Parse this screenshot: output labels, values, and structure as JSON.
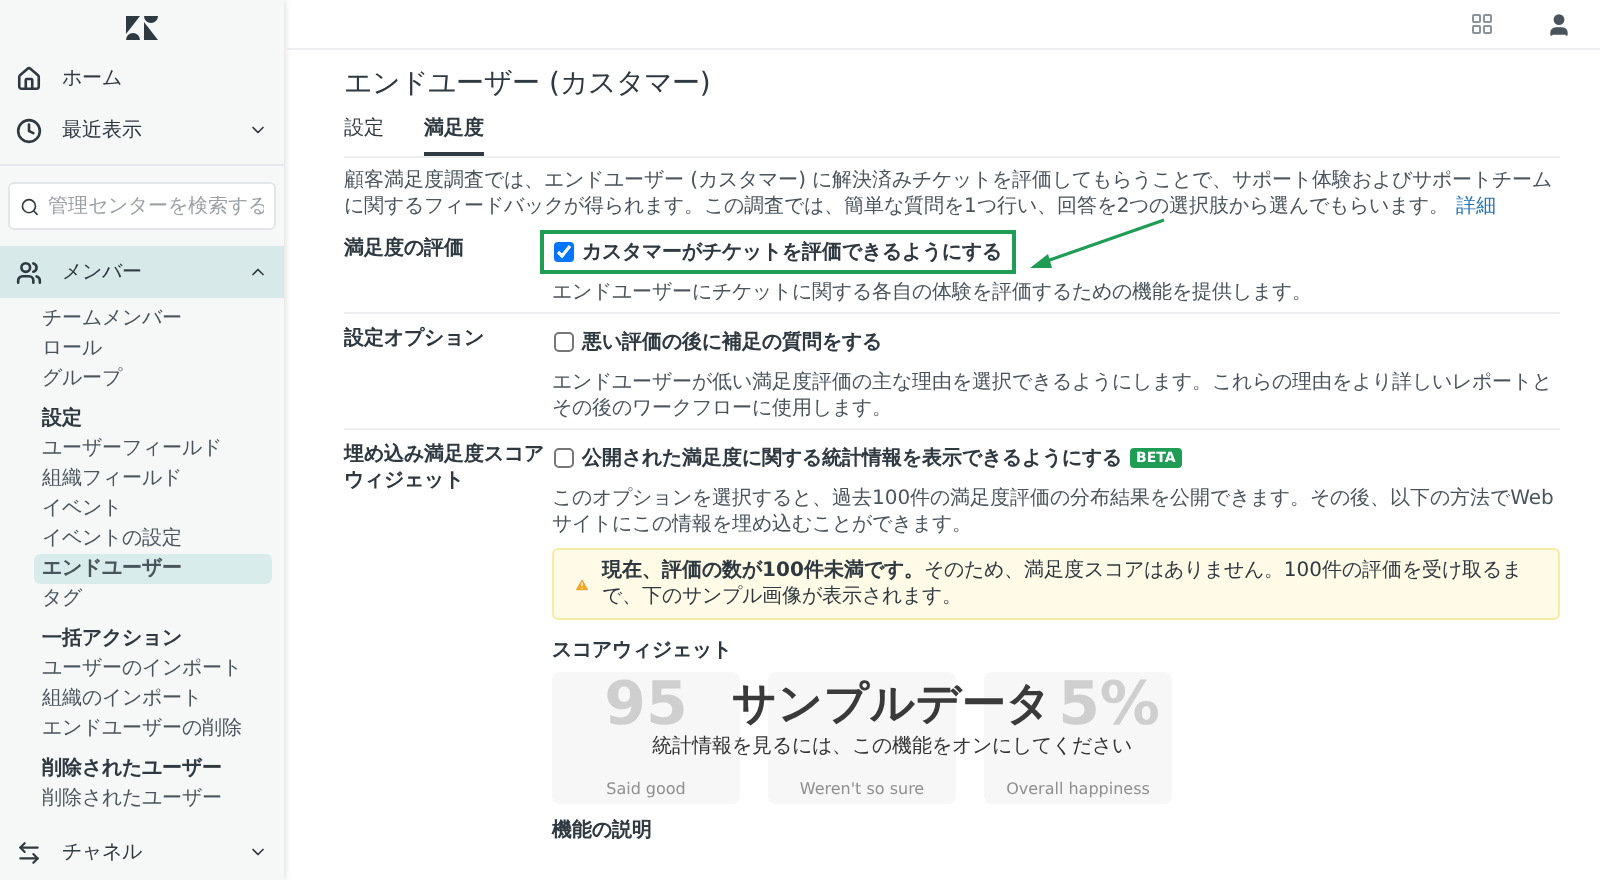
{
  "sidebar": {
    "nav": [
      {
        "label": "ホーム",
        "selected": false
      },
      {
        "label": "最近表示",
        "selected": false,
        "expanded": false
      }
    ],
    "search": {
      "placeholder": "管理センターを検索する"
    },
    "section": {
      "label": "メンバー",
      "selected": true,
      "expanded": true,
      "groups": [
        {
          "items": [
            {
              "label": "チームメンバー",
              "selected": false
            },
            {
              "label": "ロール",
              "selected": false
            },
            {
              "label": "グループ",
              "selected": false
            }
          ]
        },
        {
          "heading": "設定",
          "items": [
            {
              "label": "ユーザーフィールド",
              "selected": false
            },
            {
              "label": "組織フィールド",
              "selected": false
            },
            {
              "label": "イベント",
              "selected": false
            },
            {
              "label": "イベントの設定",
              "selected": false
            },
            {
              "label": "エンドユーザー",
              "selected": true
            },
            {
              "label": "タグ",
              "selected": false
            }
          ]
        },
        {
          "heading": "一括アクション",
          "items": [
            {
              "label": "ユーザーのインポート",
              "selected": false
            },
            {
              "label": "組織のインポート",
              "selected": false
            },
            {
              "label": "エンドユーザーの削除",
              "selected": false
            }
          ]
        },
        {
          "heading": "削除されたユーザー",
          "items": [
            {
              "label": "削除されたユーザー",
              "selected": false
            }
          ]
        }
      ]
    },
    "footer": {
      "label": "チャネル",
      "expanded": false
    }
  },
  "page": {
    "title": "エンドユーザー (カスタマー)",
    "tabs": [
      {
        "label": "設定",
        "selected": false
      },
      {
        "label": "満足度",
        "selected": true
      }
    ],
    "intro": "顧客満足度調査では、エンドユーザー (カスタマー) に解決済みチケットを評価してもらうことで、サポート体験およびサポートチームに関するフィードバックが得られます。この調査では、簡単な質問を1つ行い、回答を2つの選択肢から選んでもらいます。",
    "intro_link": "詳細",
    "settings": [
      {
        "label": "満足度の評価",
        "option": {
          "label": "カスタマーがチケットを評価できるようにする",
          "checked": true,
          "highlighted": true
        },
        "help": "エンドユーザーにチケットに関する各自の体験を評価するための機能を提供します。"
      },
      {
        "label": "設定オプション",
        "option": {
          "label": "悪い評価の後に補足の質問をする",
          "checked": false,
          "highlighted": false
        },
        "help": "エンドユーザーが低い満足度評価の主な理由を選択できるようにします。これらの理由をより詳しいレポートとその後のワークフローに使用します。"
      },
      {
        "label": "埋め込み満足度スコアウィジェット",
        "option": {
          "label": "公開された満足度に関する統計情報を表示できるようにする",
          "checked": false,
          "highlighted": false,
          "badge": "BETA"
        },
        "help": "このオプションを選択すると、過去100件の満足度評価の分布結果を公開できます。その後、以下の方法でWebサイトにこの情報を埋め込むことができます。",
        "notice": "**現在、評価の数が100件未満です。**そのため、満足度スコアはありません。100件の評価を受け取るまで、下のサンプル画像が表示されます。"
      }
    ],
    "score_widget": {
      "title": "スコアウィジェット",
      "stats": [
        {
          "value": "95",
          "label": "Said good"
        },
        {
          "label": "Weren't so sure"
        },
        {
          "value": "5%",
          "label": "Overall happiness"
        }
      ],
      "overlay_title": "サンプルデータ",
      "overlay_text": "統計情報を見るには、この機能をオンにしてください"
    },
    "feature_heading": "機能の説明"
  }
}
